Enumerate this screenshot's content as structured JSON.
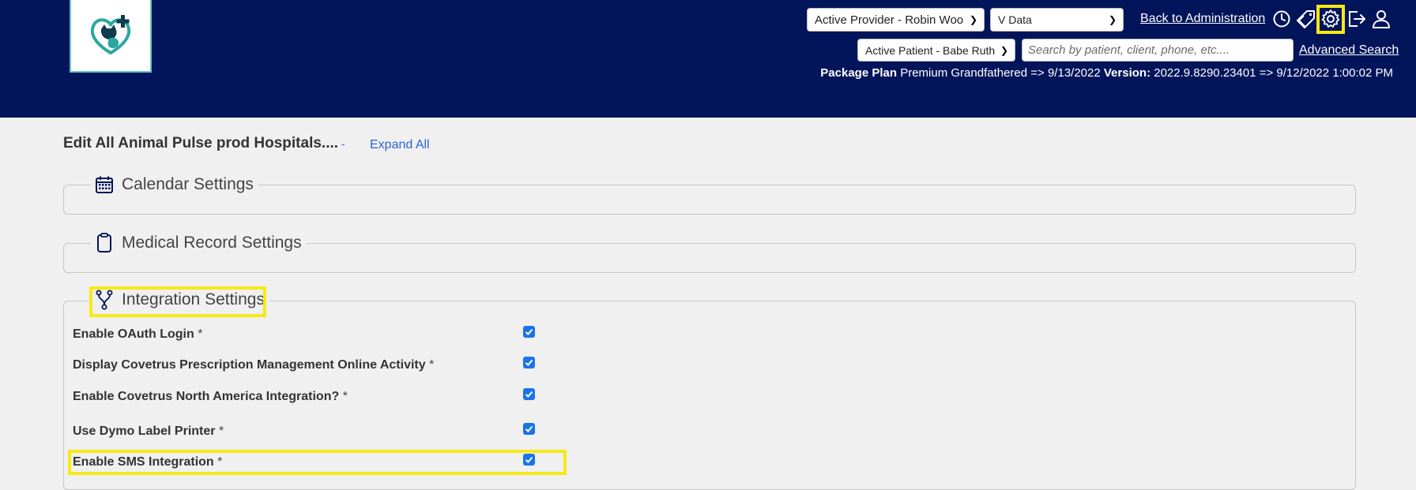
{
  "header": {
    "provider_select": "Active Provider - Robin Woo",
    "data_select": "V Data",
    "back_link": "Back to Administration",
    "patient_select": "Active Patient - Babe Ruth",
    "search_placeholder": "Search by patient, client, phone, etc....",
    "advanced_search": "Advanced Search",
    "plan_label": "Package Plan",
    "plan_value": "Premium Grandfathered => 9/13/2022",
    "version_label": "Version:",
    "version_value": "2022.9.8290.23401 => 9/12/2022 1:00:02 PM",
    "icons": [
      "clock-icon",
      "tag-icon",
      "gear-icon",
      "logout-icon",
      "user-icon"
    ]
  },
  "page": {
    "title": "Edit All Animal Pulse prod Hospitals....",
    "separator": "-",
    "expand_all": "Expand All"
  },
  "sections": {
    "calendar": "Calendar Settings",
    "medical": "Medical Record Settings",
    "integration": "Integration Settings"
  },
  "integration_rows": [
    {
      "label": "Enable OAuth Login",
      "required": "*",
      "checked": true
    },
    {
      "label": "Display Covetrus Prescription Management Online Activity",
      "required": "*",
      "checked": true
    },
    {
      "label": "Enable Covetrus North America Integration?",
      "required": "*",
      "checked": true
    },
    {
      "label": "Use Dymo Label Printer",
      "required": "*",
      "checked": true
    },
    {
      "label": "Enable SMS Integration",
      "required": "*",
      "checked": true
    }
  ],
  "colors": {
    "header_bg": "#02145a",
    "highlight": "#f6ea16",
    "checkbox": "#1a73e8",
    "link": "#2b63d6"
  }
}
